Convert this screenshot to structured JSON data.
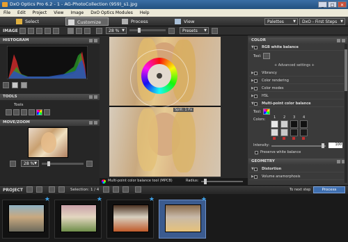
{
  "window": {
    "title": "DxO Optics Pro 6.2 - 1 - AG-PhotoCollection (959)_s1.jpg",
    "min": "_",
    "max": "□",
    "close": "✕"
  },
  "menu": [
    "File",
    "Edit",
    "Project",
    "View",
    "Image",
    "DxO Optics Modules",
    "Help"
  ],
  "modes": {
    "select": "Select",
    "customize": "Customize",
    "process": "Process",
    "view": "View",
    "palettes": "Palettes",
    "workspace": "DxO - First Steps"
  },
  "toolbar": {
    "image_label": "IMAGE",
    "zoom": "28 %",
    "presets": "Presets"
  },
  "left": {
    "histogram_title": "HISTOGRAM",
    "tools_title": "TOOLS",
    "tools_label": "Tools",
    "movezoom_title": "MOVE/ZOOM",
    "zoom": "28 %"
  },
  "center": {
    "split_label": "Split: 1 Px",
    "mpcb_label": "Multi-point color balance tool (MPCB)",
    "radius_label": "Radius:"
  },
  "right": {
    "color_title": "COLOR",
    "rgb_wb": "RGB white balance",
    "tool_label": "Tool:",
    "advanced": "+ Advanced settings +",
    "rows": [
      "Vibrancy",
      "Color rendering",
      "Color modes",
      "HSL"
    ],
    "mpcb": "Multi-point color balance",
    "tool2": "Tool:",
    "colors_label": "Colors:",
    "color_nums": [
      "1",
      "2",
      "3",
      "4"
    ],
    "intensity_label": "Intensity:",
    "intensity_value": "100",
    "preserve_wb": "Preserve white balance",
    "geometry_title": "GEOMETRY",
    "distortion": "Distortion",
    "volume": "Volume anamorphosis"
  },
  "project": {
    "label": "PROJECT",
    "selection": "Selection: 1 / 4",
    "next_step": "To next step",
    "process": "Process"
  },
  "thumbs": [
    {
      "colors": [
        "#c9a980",
        "#6d6a5c",
        "#8fb2c4"
      ]
    },
    {
      "colors": [
        "#e3d6c0",
        "#6f8e4a",
        "#c9a0a8"
      ]
    },
    {
      "colors": [
        "#d8d0c0",
        "#c05a2a",
        "#4a3020"
      ]
    },
    {
      "colors": [
        "#c8b9a8",
        "#e6c27a",
        "#8a6a4a"
      ]
    }
  ],
  "colors": {
    "accent": "#3fa2e8",
    "title": "#2a5a8e"
  }
}
